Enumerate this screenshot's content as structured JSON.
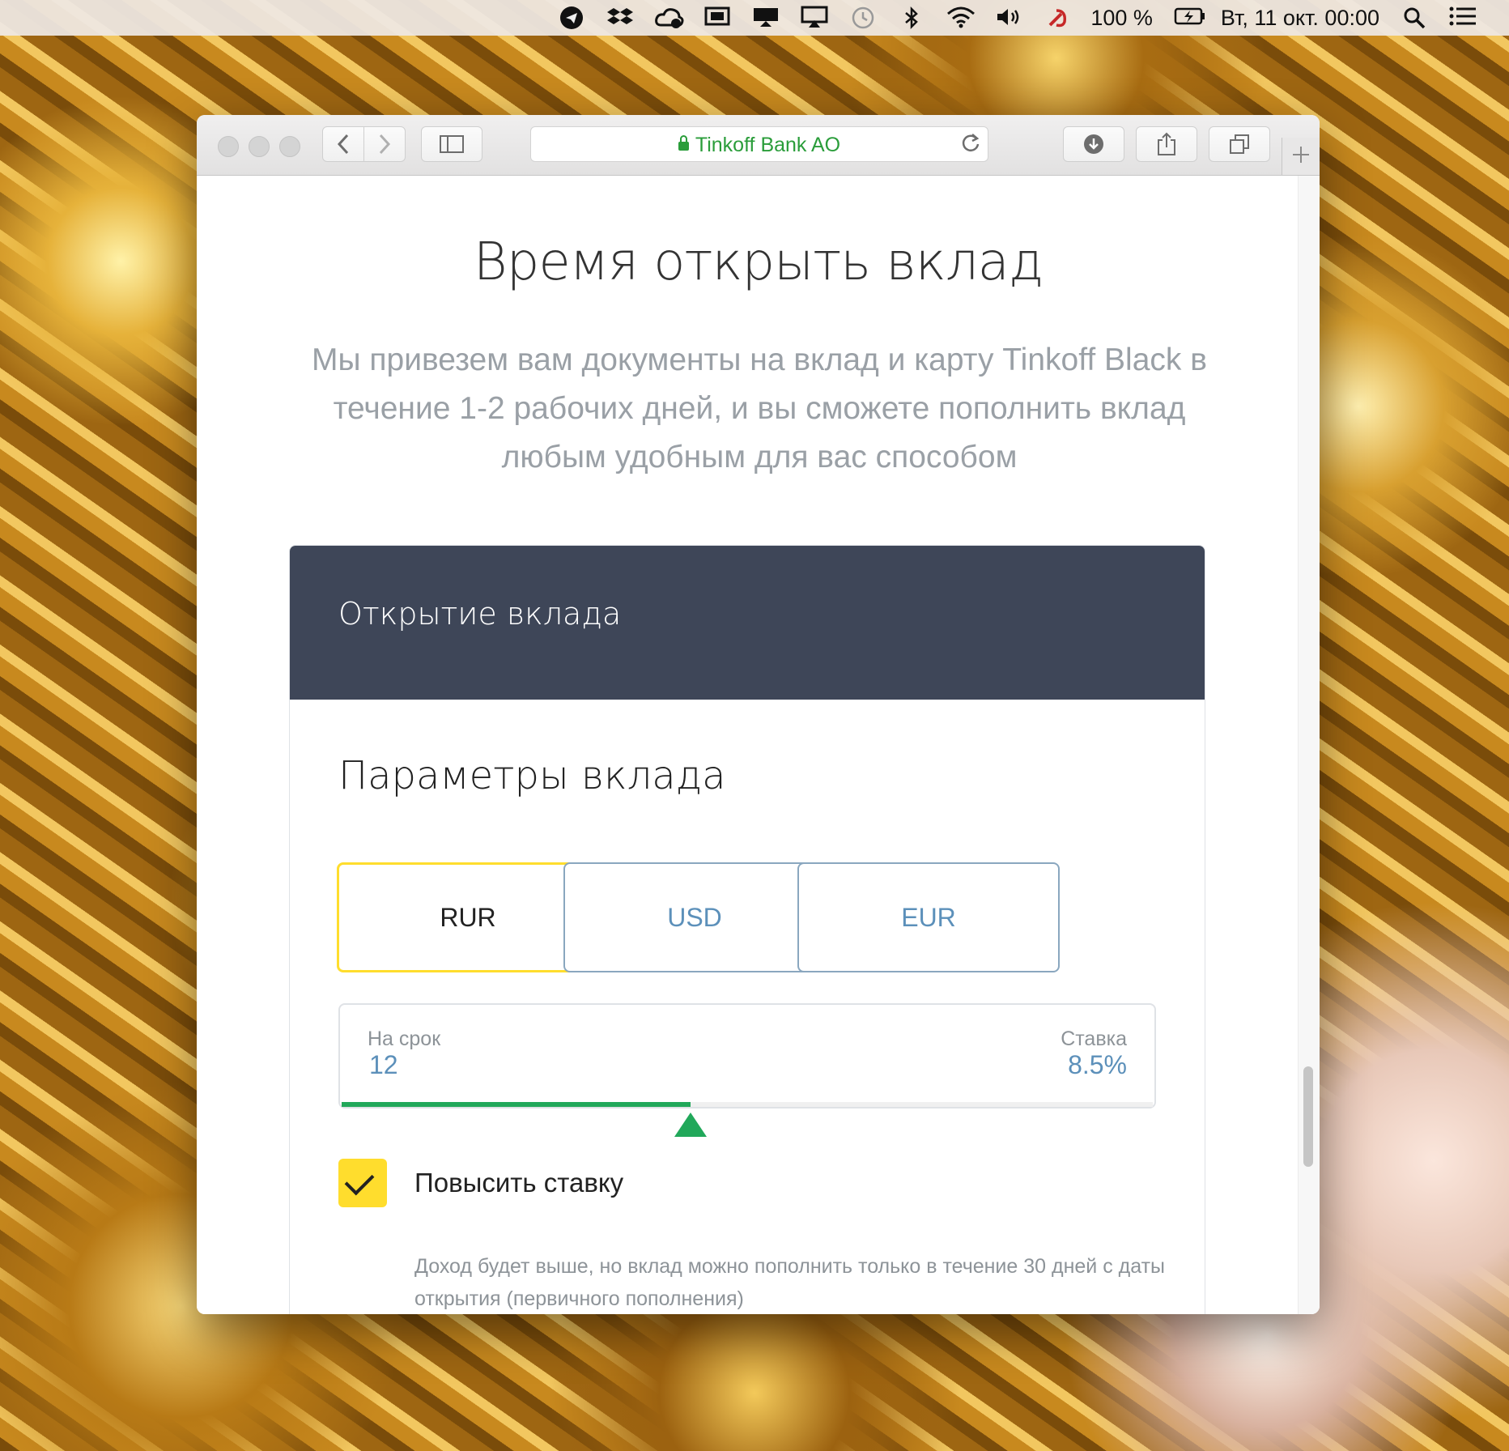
{
  "menubar": {
    "icons": [
      "telegram-icon",
      "dropbox-icon",
      "creative-cloud-icon",
      "screen-icon",
      "display-icon",
      "airplay-icon",
      "time-machine-icon",
      "bluetooth-icon",
      "wifi-icon",
      "volume-icon",
      "hammer-sickle-icon"
    ],
    "battery_label": "100 %",
    "datetime": "Вт, 11 окт.  00:00"
  },
  "browser": {
    "address_label": "Tinkoff Bank AO",
    "accent": "#2a9d3a"
  },
  "page": {
    "title": "Время открыть вклад",
    "subtitle": "Мы привезем вам документы на вклад и карту Tinkoff Black в течение 1-2 рабочих дней, и вы сможете пополнить вклад любым удобным для вас способом"
  },
  "card": {
    "header_title": "Открытие вклада",
    "section_title": "Параметры вклада",
    "currencies": [
      {
        "label": "RUR",
        "selected": true
      },
      {
        "label": "USD",
        "selected": false
      },
      {
        "label": "EUR",
        "selected": false
      }
    ],
    "term": {
      "label": "На срок",
      "value": "12",
      "progress_fraction": 0.43
    },
    "rate": {
      "label": "Ставка",
      "value": "8.5%"
    },
    "increase_rate": {
      "checked": true,
      "label": "Повысить ставку"
    },
    "note": "Доход будет выше, но вклад можно пополнить только в течение 30 дней с даты открытия (первичного пополнения)"
  },
  "colors": {
    "header_bg": "#3e4658",
    "selected_border": "#ffdd2d",
    "link_blue": "#5c90ba",
    "slider_green": "#21a85a"
  }
}
